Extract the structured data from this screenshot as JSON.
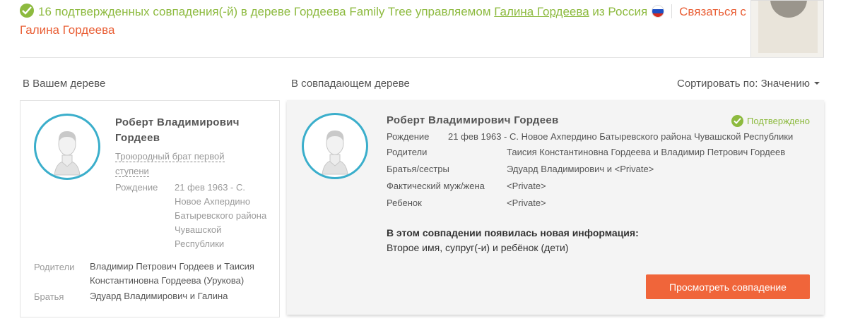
{
  "header": {
    "summary_pre": "16 подтвержденных совпадения(-й) в дереве Гордеева Family Tree управляемом",
    "manager_name": "Галина Гордеева",
    "country_pre": "из Россия",
    "contact_label": "Связаться с Галина Гордеева",
    "flag_colors": [
      "#ffffff",
      "#1f4fc3",
      "#d52b1e"
    ],
    "accent_color": "#8dba3f",
    "contact_color": "#e95f36"
  },
  "columns": {
    "your_tree": "В Вашем дереве",
    "matching_tree": "В совпадающем дереве",
    "sort_label": "Сортировать по: Значению"
  },
  "left_card": {
    "name": "Роберт Владимирович Гордеев",
    "relation": "Троюродный брат первой ступени",
    "birth_label": "Рождение",
    "birth_value": "21 фев 1963 - С. Новое Ахпердино Батыревского района Чувашской Республики",
    "parents_label": "Родители",
    "parents_value": "Владимир Петрович Гордеев и Таисия Константиновна Гордеева (Урукова)",
    "siblings_label": "Братья",
    "siblings_value": "Эдуард Владимирович и Галина"
  },
  "right_card": {
    "name": "Роберт Владимирович Гордеев",
    "status": "Подтверждено",
    "rows": [
      {
        "label": "Рождение",
        "value": "21 фев 1963 - С. Новое Ахпердино Батыревского района Чувашской Республики"
      },
      {
        "label": "Родители",
        "value": "Таисия Константиновна Гордеева и Владимир Петрович Гордеев"
      },
      {
        "label": "Братья/сестры",
        "value": "Эдуард Владимирович и <Private>"
      },
      {
        "label": "Фактический муж/жена",
        "value": "<Private>"
      },
      {
        "label": "Ребенок",
        "value": "<Private>"
      }
    ],
    "new_info_title": "В этом совпадении появилась новая информация:",
    "new_info_text": "Второе имя, супруг(-и) и ребёнок (дети)",
    "view_button": "Просмотреть совпадение",
    "button_color": "#f0653a",
    "avatar_ring_color": "#3aaecb"
  }
}
